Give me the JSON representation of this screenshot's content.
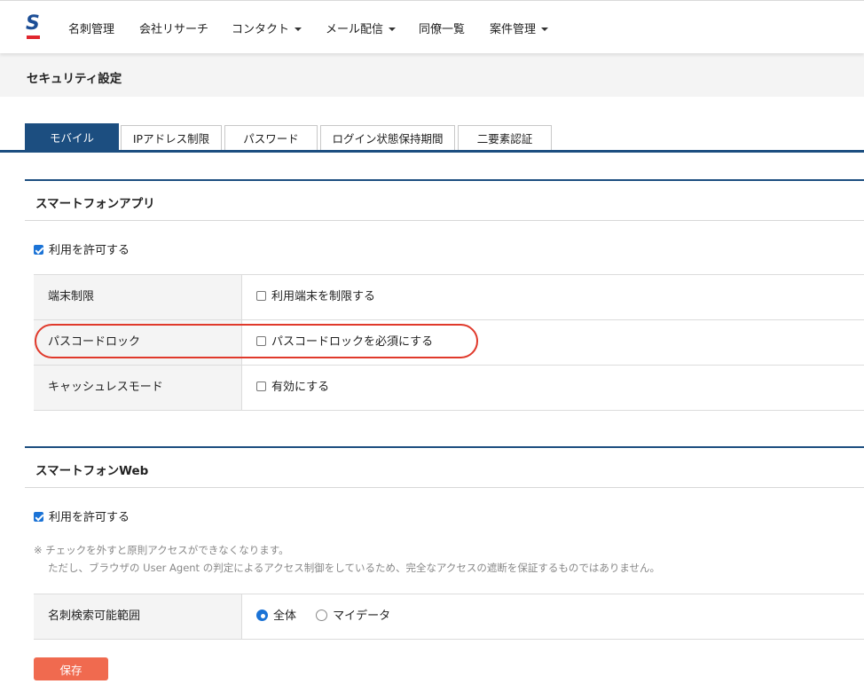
{
  "nav": {
    "items": [
      {
        "label": "名刺管理"
      },
      {
        "label": "会社リサーチ"
      },
      {
        "label": "コンタクト"
      },
      {
        "label": "メール配信"
      },
      {
        "label": "同僚一覧"
      },
      {
        "label": "案件管理"
      }
    ]
  },
  "page": {
    "title": "セキュリティ設定"
  },
  "tabs": [
    {
      "label": "モバイル",
      "active": true
    },
    {
      "label": "IPアドレス制限"
    },
    {
      "label": "パスワード"
    },
    {
      "label": "ログイン状態保持期間"
    },
    {
      "label": "二要素認証"
    }
  ],
  "app_section": {
    "title": "スマートフォンアプリ",
    "allow_label": "利用を許可する",
    "allow_checked": true,
    "rows": [
      {
        "label": "端末制限",
        "option": "利用端末を制限する",
        "checked": false
      },
      {
        "label": "パスコードロック",
        "option": "パスコードロックを必須にする",
        "checked": false
      },
      {
        "label": "キャッシュレスモード",
        "option": "有効にする",
        "checked": false
      }
    ]
  },
  "web_section": {
    "title": "スマートフォンWeb",
    "allow_label": "利用を許可する",
    "allow_checked": true,
    "note_line1": "※ チェックを外すと原則アクセスができなくなります。",
    "note_line2": "ただし、ブラウザの User Agent の判定によるアクセス制御をしているため、完全なアクセスの遮断を保証するものではありません。",
    "scope_row": {
      "label": "名刺検索可能範囲",
      "options": [
        {
          "label": "全体",
          "selected": true
        },
        {
          "label": "マイデータ",
          "selected": false
        }
      ]
    }
  },
  "save_label": "保存",
  "colors": {
    "brand_navy": "#1c4e80",
    "checkbox_blue": "#1b73d6",
    "save_orange": "#f06a4f",
    "highlight_red": "#e0392b"
  }
}
